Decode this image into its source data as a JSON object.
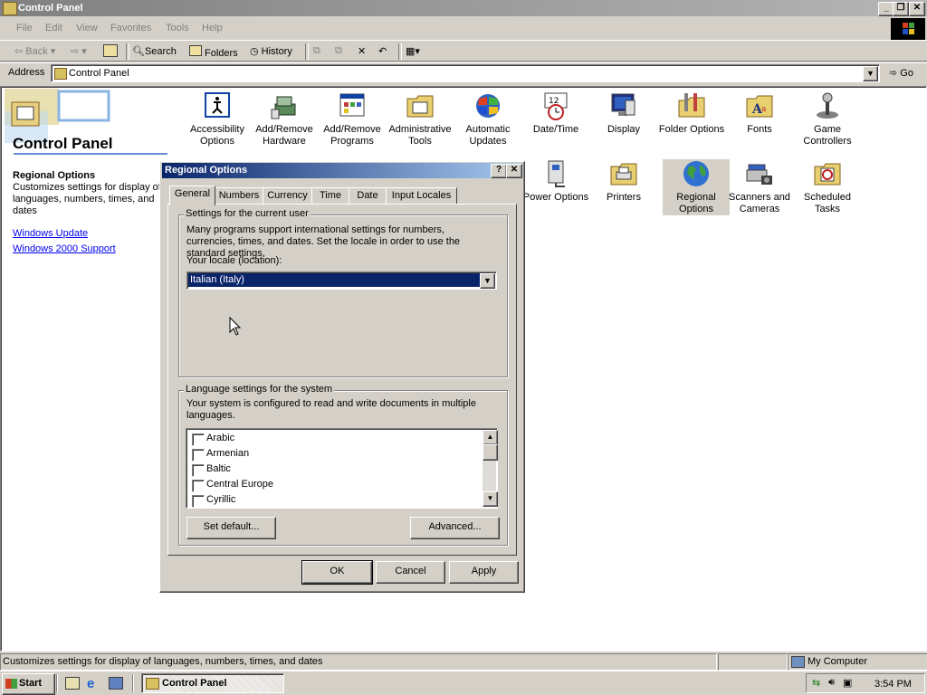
{
  "window": {
    "title": "Control Panel",
    "minimize": "_",
    "restore": "❐",
    "close": "✕"
  },
  "menu": [
    "File",
    "Edit",
    "View",
    "Favorites",
    "Tools",
    "Help"
  ],
  "toolbar": {
    "back": "Back",
    "search": "Search",
    "folders": "Folders",
    "history": "History"
  },
  "address": {
    "label": "Address",
    "value": "Control Panel",
    "go": "Go"
  },
  "sidebar": {
    "title": "Control Panel",
    "section_title": "Regional Options",
    "section_desc": "Customizes settings for display of languages, numbers, times, and dates",
    "links": [
      "Windows Update",
      "Windows 2000 Support"
    ]
  },
  "icons_row1": [
    {
      "label": "Accessibility Options",
      "icon": "accessibility-icon"
    },
    {
      "label": "Add/Remove Hardware",
      "icon": "hardware-icon"
    },
    {
      "label": "Add/Remove Programs",
      "icon": "programs-icon"
    },
    {
      "label": "Administrative Tools",
      "icon": "admin-tools-icon"
    },
    {
      "label": "Automatic Updates",
      "icon": "updates-icon"
    },
    {
      "label": "Date/Time",
      "icon": "clock-icon"
    },
    {
      "label": "Display",
      "icon": "display-icon"
    },
    {
      "label": "Folder Options",
      "icon": "folder-options-icon"
    },
    {
      "label": "Fonts",
      "icon": "fonts-icon"
    },
    {
      "label": "Game Controllers",
      "icon": "joystick-icon"
    }
  ],
  "icons_row2": [
    {
      "label": "Power Options",
      "icon": "power-icon"
    },
    {
      "label": "Printers",
      "icon": "printer-icon"
    },
    {
      "label": "Regional Options",
      "icon": "globe-icon"
    },
    {
      "label": "Scanners and Cameras",
      "icon": "scanner-icon"
    },
    {
      "label": "Scheduled Tasks",
      "icon": "tasks-icon"
    }
  ],
  "dialog": {
    "title": "Regional Options",
    "help": "?",
    "close": "✕",
    "tabs": [
      "General",
      "Numbers",
      "Currency",
      "Time",
      "Date",
      "Input Locales"
    ],
    "user_group": "Settings for the current user",
    "user_desc": "Many programs support international settings for numbers, currencies, times, and dates. Set the locale in order to use the standard settings.",
    "locale_label": "Your locale (location):",
    "locale_value": "Italian (Italy)",
    "system_group": "Language settings for the system",
    "system_desc": "Your system is configured to read and write documents in multiple languages.",
    "languages": [
      "Arabic",
      "Armenian",
      "Baltic",
      "Central Europe",
      "Cyrillic"
    ],
    "set_default": "Set default...",
    "advanced": "Advanced...",
    "ok": "OK",
    "cancel": "Cancel",
    "apply": "Apply"
  },
  "status": {
    "text": "Customizes settings for display of languages, numbers, times, and dates",
    "zone": "My Computer"
  },
  "taskbar": {
    "start": "Start",
    "task": "Control Panel",
    "clock": "3:54 PM"
  }
}
